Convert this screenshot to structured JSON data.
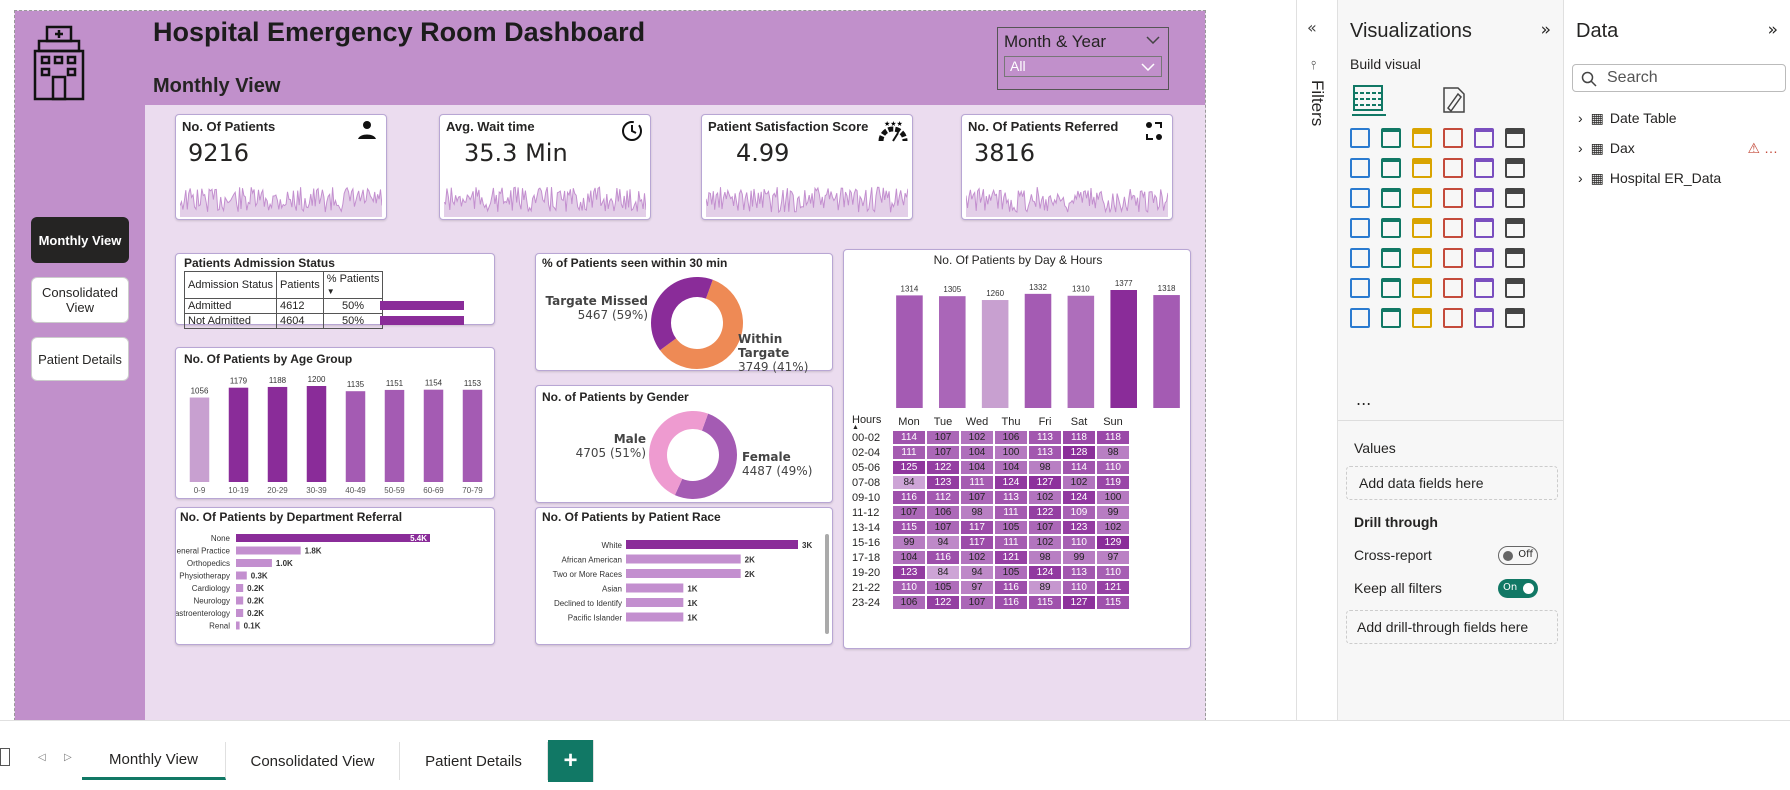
{
  "header": {
    "title": "Hospital Emergency Room Dashboard",
    "subtitle": "Monthly View"
  },
  "slicer": {
    "label": "Month & Year",
    "value": "All"
  },
  "nav": [
    {
      "label": "Monthly View"
    },
    {
      "label": "Consolidated View"
    },
    {
      "label": "Patient Details"
    }
  ],
  "kpis": [
    {
      "label": "No. Of Patients",
      "value": "9216",
      "icon": "patient-icon"
    },
    {
      "label": "Avg. Wait time",
      "value": "35.3 Min",
      "icon": "clock-icon"
    },
    {
      "label": "Patient Satisfaction Score",
      "value": "4.99",
      "icon": "gauge-icon"
    },
    {
      "label": "No. Of Patients Referred",
      "value": "3816",
      "icon": "referral-icon"
    }
  ],
  "admission": {
    "title": "Patients Admission Status",
    "headers": [
      "Admission Status",
      "Patients",
      "% Patients"
    ],
    "rows": [
      [
        "Admitted",
        "4612",
        "50%"
      ],
      [
        "Not Admitted",
        "4604",
        "50%"
      ]
    ]
  },
  "seen30": {
    "title": "% of Patients seen within 30 min",
    "missed_label": "Targate Missed",
    "missed_value": "5467 (59%)",
    "within_label": "Within Targate",
    "within_value": "3749 (41%)"
  },
  "gender": {
    "title": "No. of Patients by Gender",
    "male_label": "Male",
    "male_value": "4705 (51%)",
    "female_label": "Female",
    "female_value": "4487 (49%)"
  },
  "age": {
    "title": "No. Of Patients by Age Group"
  },
  "dept": {
    "title": "No. Of Patients by Department Referral"
  },
  "race": {
    "title": "No. Of Patients by Patient Race"
  },
  "dayhour": {
    "title": "No. Of Patients by Day & Hours",
    "hours_label": "Hours"
  },
  "colors": {
    "accent": "#c190cb",
    "dark": "#8a2c99",
    "mid": "#a45bb3",
    "light": "#c8a0d0",
    "orange": "#ee8a55",
    "pink": "#ee9bd0",
    "teal": "#117865"
  },
  "chart_data": [
    {
      "type": "donut",
      "title": "% of Patients seen within 30 min",
      "labels": [
        "Targate Missed",
        "Within Targate"
      ],
      "values": [
        5467,
        3749
      ]
    },
    {
      "type": "donut",
      "title": "No. of Patients by Gender",
      "labels": [
        "Male",
        "Female"
      ],
      "values": [
        4705,
        4487
      ]
    },
    {
      "type": "bar",
      "title": "No. Of Patients by Age Group",
      "categories": [
        "0-9",
        "10-19",
        "20-29",
        "30-39",
        "40-49",
        "50-59",
        "60-69",
        "70-79"
      ],
      "values": [
        1056,
        1179,
        1188,
        1200,
        1135,
        1151,
        1154,
        1153
      ]
    },
    {
      "type": "bar",
      "orientation": "horizontal",
      "title": "No. Of Patients by Department Referral",
      "categories": [
        "None",
        "General Practice",
        "Orthopedics",
        "Physiotherapy",
        "Cardiology",
        "Neurology",
        "Gastroenterology",
        "Renal"
      ],
      "values": [
        5400,
        1800,
        1000,
        300,
        200,
        200,
        200,
        100
      ],
      "labels": [
        "5.4K",
        "1.8K",
        "1.0K",
        "0.3K",
        "0.2K",
        "0.2K",
        "0.2K",
        "0.1K"
      ]
    },
    {
      "type": "bar",
      "orientation": "horizontal",
      "title": "No. Of Patients by Patient Race",
      "categories": [
        "White",
        "African American",
        "Two or More Races",
        "Asian",
        "Declined to Identify",
        "Pacific Islander"
      ],
      "values": [
        3000,
        2000,
        2000,
        1000,
        1000,
        1000
      ],
      "labels": [
        "3K",
        "2K",
        "2K",
        "1K",
        "1K",
        "1K"
      ]
    },
    {
      "type": "bar",
      "title": "No. Of Patients by Day & Hours",
      "categories": [
        "Mon",
        "Tue",
        "Wed",
        "Thu",
        "Fri",
        "Sat",
        "Sun"
      ],
      "values": [
        1314,
        1305,
        1260,
        1332,
        1310,
        1377,
        1318
      ]
    },
    {
      "type": "heatmap",
      "title": "No. Of Patients by Day & Hours",
      "x": [
        "Mon",
        "Tue",
        "Wed",
        "Thu",
        "Fri",
        "Sat",
        "Sun"
      ],
      "y": [
        "00-02",
        "02-04",
        "05-06",
        "07-08",
        "09-10",
        "11-12",
        "13-14",
        "15-16",
        "17-18",
        "19-20",
        "21-22",
        "23-24"
      ],
      "values": [
        [
          114,
          107,
          102,
          106,
          113,
          118,
          118
        ],
        [
          111,
          107,
          104,
          100,
          113,
          128,
          98
        ],
        [
          125,
          122,
          104,
          104,
          98,
          114,
          110
        ],
        [
          84,
          123,
          111,
          124,
          127,
          102,
          119
        ],
        [
          116,
          112,
          107,
          113,
          102,
          124,
          100
        ],
        [
          107,
          106,
          98,
          111,
          122,
          109,
          99
        ],
        [
          115,
          107,
          117,
          105,
          107,
          123,
          102
        ],
        [
          99,
          94,
          117,
          111,
          102,
          110,
          129
        ],
        [
          104,
          116,
          102,
          121,
          98,
          99,
          97
        ],
        [
          123,
          84,
          94,
          105,
          124,
          113,
          110
        ],
        [
          110,
          105,
          97,
          116,
          89,
          110,
          121
        ],
        [
          106,
          122,
          107,
          116,
          115,
          127,
          115
        ]
      ]
    }
  ],
  "viz_pane": {
    "title": "Visualizations",
    "build": "Build visual",
    "values_label": "Values",
    "add_data": "Add data fields here",
    "drill": "Drill through",
    "cross": "Cross-report",
    "cross_state": "Off",
    "keep": "Keep all filters",
    "keep_state": "On",
    "add_drill": "Add drill-through fields here",
    "more": "..."
  },
  "filters_label": "Filters",
  "data_pane": {
    "title": "Data",
    "search": "Search",
    "tables": [
      "Date Table",
      "Dax",
      "Hospital ER_Data"
    ]
  },
  "tabs": [
    "Monthly View",
    "Consolidated View",
    "Patient Details"
  ],
  "add_tab": "+"
}
